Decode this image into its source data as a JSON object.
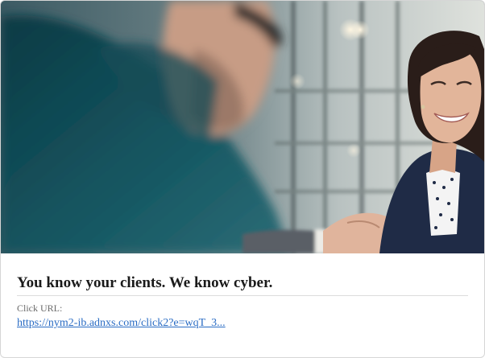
{
  "ad": {
    "image_alt": "Two people shaking hands in an office",
    "headline": "You know your clients. We know cyber.",
    "click_url_label": "Click URL:",
    "click_url": "https://nym2-ib.adnxs.com/click2?e=wqT_3..."
  },
  "colors": {
    "link": "#2a6cc4",
    "headline": "#1a1a1a",
    "label": "#6b6b6b",
    "border": "#d6d6d6"
  }
}
